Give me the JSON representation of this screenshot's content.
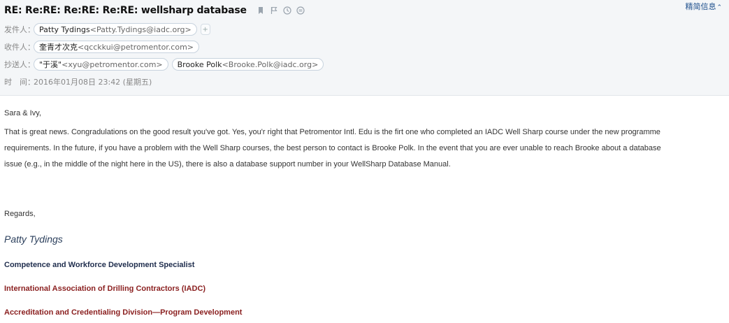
{
  "header": {
    "subject": "RE: Re:RE: Re:RE: Re:RE: wellsharp database",
    "details_link": "精简信息",
    "icons": [
      "bookmark-icon",
      "flag-icon",
      "clock-icon",
      "more-icon"
    ],
    "from": {
      "label": "发件人：",
      "name": "Patty Tydings",
      "address": "<Patty.Tydings@iadc.org>",
      "add_label": "+"
    },
    "to": {
      "label": "收件人：",
      "name": "奎青才次克",
      "address": "<qcckkui@petromentor.com>"
    },
    "cc": {
      "label": "抄送人：",
      "recipients": [
        {
          "name": "\"于溪\"",
          "address": "<xyu@petromentor.com>"
        },
        {
          "name": "Brooke Polk",
          "address": "<Brooke.Polk@iadc.org>"
        }
      ]
    },
    "time": {
      "label": "时　间：",
      "value": "2016年01月08日 23:42 (星期五)"
    }
  },
  "body": {
    "greeting": "Sara & Ivy,",
    "lines": [
      "That is great news. Congradulations on the good result you've got. Yes, you'r right that Petromentor Intl. Edu is the firt one who completed an IADC Well Sharp course under the new programme",
      "requirements. In the future, if you have a problem with the Well Sharp courses, the best person to contact is Brooke Polk. In the event that you are ever unable to reach Brooke about a database",
      "issue (e.g., in the middle of the night here in the US), there is also a database support number in your WellSharp Database Manual."
    ],
    "regards": "Regards,",
    "signature": {
      "name": "Patty Tydings",
      "title": "Competence and Workforce Development Specialist",
      "organization": "International Association of Drilling Contractors (IADC)",
      "division": "Accreditation and Credentialing Division—Program Development"
    }
  },
  "colors": {
    "header_bg": "#f4f6f8",
    "link": "#1d4f8c",
    "signature_red": "#8a1f1f",
    "signature_navy": "#1f2d4d"
  }
}
